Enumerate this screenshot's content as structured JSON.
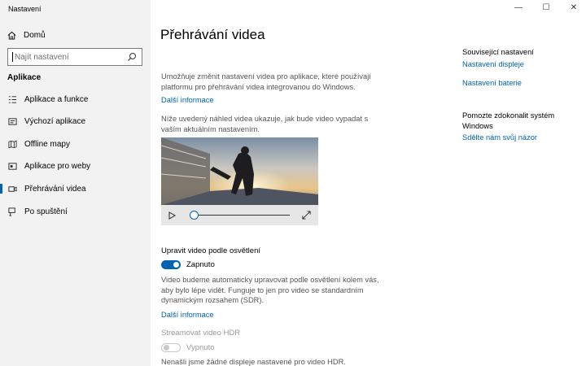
{
  "window": {
    "title": "Nastavení",
    "minimize": "—",
    "maximize": "☐",
    "close": "✕"
  },
  "sidebar": {
    "home": "Domů",
    "search_placeholder": "Najít nastavení",
    "section": "Aplikace",
    "items": [
      {
        "label": "Aplikace a funkce",
        "icon": "apps-list-icon"
      },
      {
        "label": "Výchozí aplikace",
        "icon": "default-apps-icon"
      },
      {
        "label": "Offline mapy",
        "icon": "map-icon"
      },
      {
        "label": "Aplikace pro weby",
        "icon": "web-apps-icon"
      },
      {
        "label": "Přehrávání videa",
        "icon": "video-icon",
        "active": true
      },
      {
        "label": "Po spuštění",
        "icon": "startup-icon"
      }
    ]
  },
  "main": {
    "title": "Přehrávání videa",
    "intro": "Umožňuje změnit nastavení videa pro aplikace, které používají platformu pro přehrávání videa integrovanou do Windows.",
    "more_info_1": "Další informace",
    "preview_text": "Níže uvedený náhled videa ukazuje, jak bude video vypadat s vaším aktuálním nastavením.",
    "video": {
      "progress": 0.0
    },
    "lighting_heading": "Upravit video podle osvětlení",
    "lighting_toggle": "Zapnuto",
    "lighting_desc": "Video budeme automaticky upravovat podle osvětlení kolem vás, aby bylo lépe vidět. Funguje to jen pro video se standardním dynamickým rozsahem (SDR).",
    "more_info_2": "Další informace",
    "hdr_heading": "Streamovat video HDR",
    "hdr_toggle": "Vypnuto",
    "hdr_note": "Nenašli jsme žádné displeje nastavené pro video HDR."
  },
  "related": {
    "heading": "Související nastavení",
    "links": [
      "Nastavení displeje",
      "Nastavení baterie"
    ],
    "help_heading": "Pomozte zdokonalit systém Windows",
    "feedback": "Sdělte nám svůj názor"
  },
  "colors": {
    "accent": "#0063b1",
    "sidebar_bg": "#f2f2f2"
  }
}
